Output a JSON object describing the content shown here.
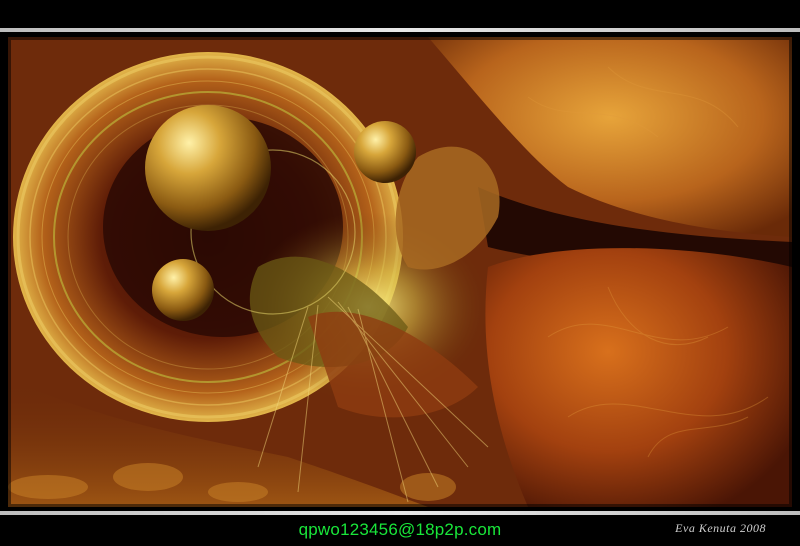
{
  "watermark": {
    "email": "qpwo123456@18p2p.com"
  },
  "artist_signature": {
    "text": "Eva Kenuta 2008"
  },
  "palette": {
    "frame": "#000000",
    "rule": "#d8d8d8",
    "email_green": "#19e63a",
    "gold": "#d6a531",
    "rust": "#a8430f",
    "deep_brown": "#2a0c03"
  }
}
